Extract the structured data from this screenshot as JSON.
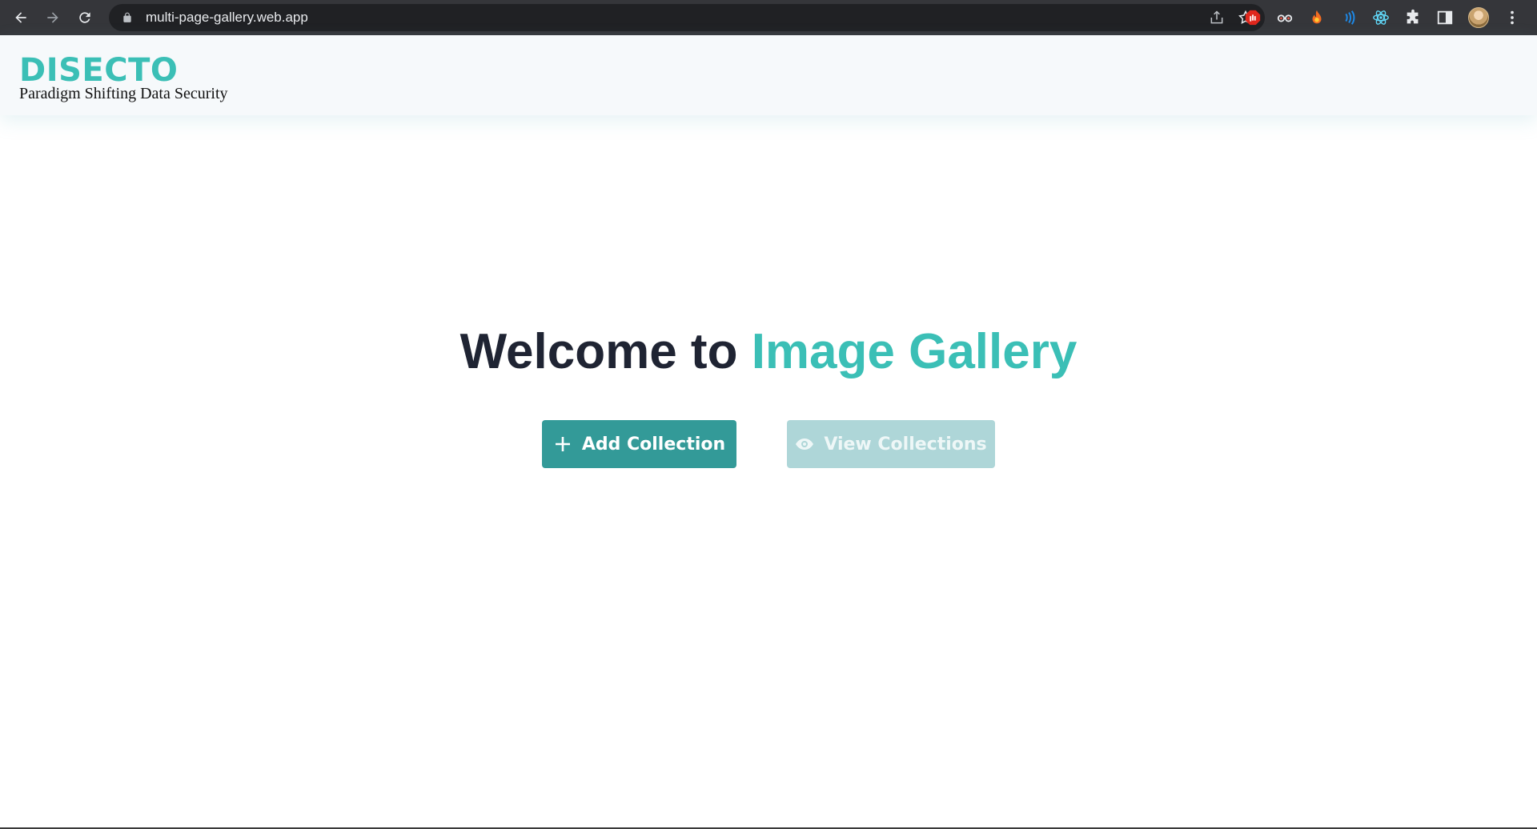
{
  "browser": {
    "url": "multi-page-gallery.web.app",
    "extensions": [
      "adblock-icon",
      "glasses-icon",
      "flame-icon",
      "wave-icon",
      "react-icon",
      "puzzle-icon",
      "side-panel-icon"
    ]
  },
  "header": {
    "logo_text": "DISECTO",
    "tagline": "Paradigm Shifting Data Security"
  },
  "hero": {
    "title_prefix": "Welcome to ",
    "title_accent": "Image Gallery"
  },
  "actions": {
    "add_label": "Add Collection",
    "view_label": "View Collections"
  },
  "colors": {
    "accent": "#3bbfb6",
    "primary_button": "#339a98",
    "disabled_button": "#aed6d8",
    "heading": "#1f2433"
  }
}
